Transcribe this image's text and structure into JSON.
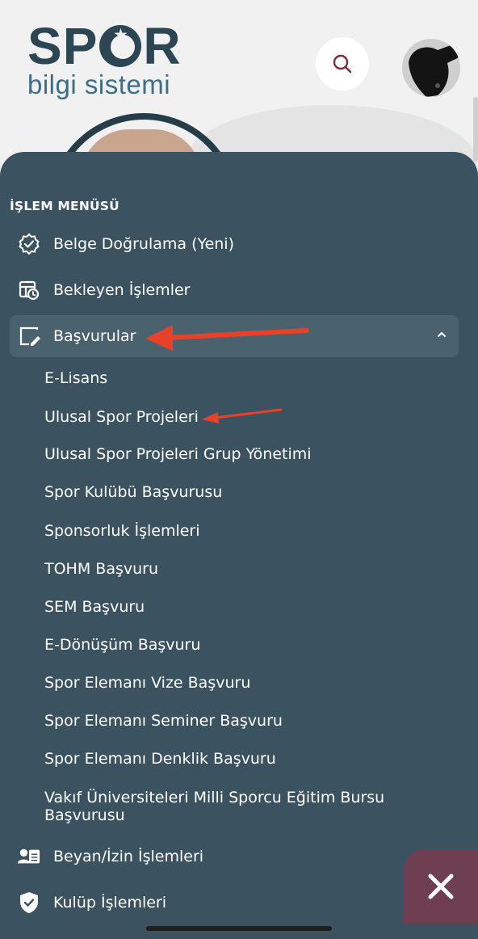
{
  "header": {
    "logo_main_left": "SP",
    "logo_main_right": "R",
    "logo_sub": "bilgi sistemi"
  },
  "menu": {
    "title": "İŞLEM MENÜSÜ",
    "items": [
      {
        "label": "Belge Doğrulama (Yeni)",
        "icon": "verified-badge-icon"
      },
      {
        "label": "Bekleyen İşlemler",
        "icon": "pending-table-icon"
      },
      {
        "label": "Başvurular",
        "icon": "edit-note-icon",
        "expanded": true
      },
      {
        "label": "Beyan/İzin İşlemleri",
        "icon": "user-card-icon"
      },
      {
        "label": "Kulüp İşlemleri",
        "icon": "shield-check-icon"
      }
    ],
    "submenu": [
      "E-Lisans",
      "Ulusal Spor Projeleri",
      "Ulusal Spor Projeleri Grup Yönetimi",
      "Spor Kulübü Başvurusu",
      "Sponsorluk İşlemleri",
      "TOHM Başvuru",
      "SEM Başvuru",
      "E-Dönüşüm Başvuru",
      "Spor Elemanı Vize Başvuru",
      "Spor Elemanı Seminer Başvuru",
      "Spor Elemanı Denklik Başvuru",
      "Vakıf Üniversiteleri Milli Sporcu Eğitim Bursu Başvurusu"
    ]
  },
  "colors": {
    "drawer": "#3b5260",
    "active_item": "#4a616e",
    "brand": "#2c4654",
    "annotation_arrow": "#e8412a",
    "fab": "#6e3e51"
  }
}
